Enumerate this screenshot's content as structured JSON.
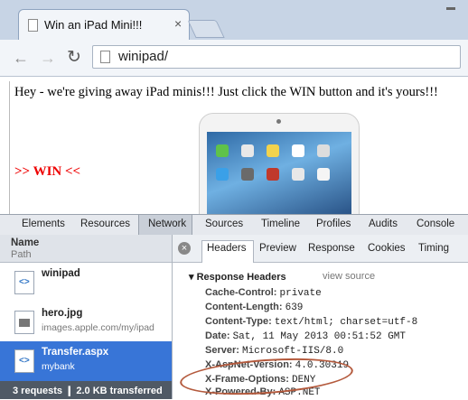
{
  "browser": {
    "tab_title": "Win an iPad Mini!!!",
    "tab_close": "×",
    "url": "winipad/"
  },
  "page": {
    "headline": "Hey - we're giving away iPad minis!!! Just click the WIN button and it's yours!!!",
    "win_link": ">> WIN <<"
  },
  "devtools": {
    "tabs": [
      "Elements",
      "Resources",
      "Network",
      "Sources",
      "Timeline",
      "Profiles",
      "Audits",
      "Console"
    ],
    "active_tab": "Network",
    "columns": {
      "name": "Name",
      "path": "Path"
    },
    "requests": [
      {
        "name": "winipad",
        "path": ""
      },
      {
        "name": "hero.jpg",
        "path": "images.apple.com/my/ipad"
      },
      {
        "name": "Transfer.aspx",
        "path": "mybank"
      }
    ],
    "selected_request": "Transfer.aspx",
    "status": "3 requests ❙ 2.0 KB transferred",
    "detail_tabs": [
      "Headers",
      "Preview",
      "Response",
      "Cookies",
      "Timing"
    ],
    "active_detail_tab": "Headers",
    "response_headers_title": "Response Headers",
    "view_source": "view source",
    "headers": [
      {
        "key": "Cache-Control:",
        "value": "private"
      },
      {
        "key": "Content-Length:",
        "value": "639"
      },
      {
        "key": "Content-Type:",
        "value": "text/html; charset=utf-8"
      },
      {
        "key": "Date:",
        "value": "Sat, 11 May 2013 00:51:52 GMT"
      },
      {
        "key": "Server:",
        "value": "Microsoft-IIS/8.0"
      },
      {
        "key": "X-AspNet-Version:",
        "value": "4.0.30319"
      },
      {
        "key": "X-Frame-Options:",
        "value": "DENY"
      },
      {
        "key": "X-Powered-By:",
        "value": "ASP.NET"
      }
    ]
  },
  "icons": [
    "page-icon",
    "back-arrow-icon",
    "forward-arrow-icon",
    "reload-icon",
    "clear-icon",
    "html-file-icon",
    "image-file-icon",
    "triangle-down-icon"
  ],
  "colors": {
    "selected_row": "#3875d7",
    "win_link": "#e00000",
    "annotation_oval": "#b45a3d"
  }
}
